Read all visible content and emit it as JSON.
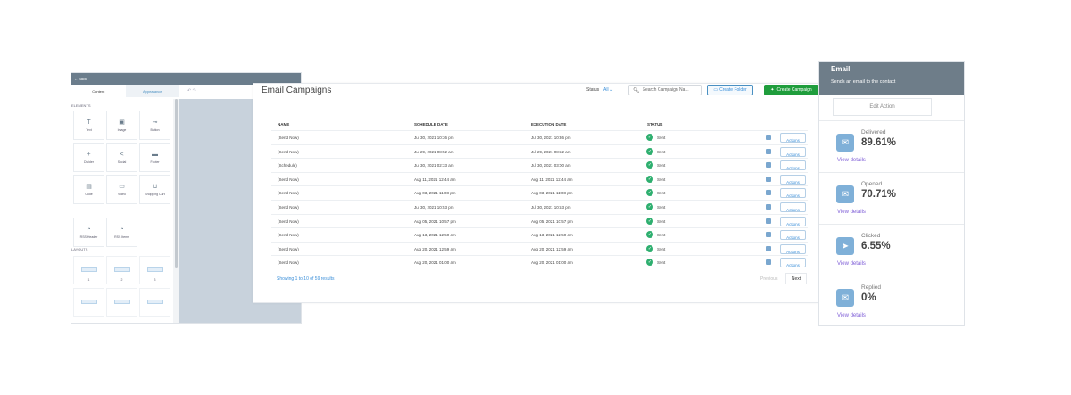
{
  "editor": {
    "back_label": "Back",
    "tabs": [
      "Content",
      "Appearance"
    ],
    "undo": "↶ ↷",
    "elements_heading": "ELEMENTS",
    "elements": [
      {
        "label": "Text",
        "icon": "text-icon",
        "glyph": "T"
      },
      {
        "label": "Image",
        "icon": "image-icon",
        "glyph": "▣"
      },
      {
        "label": "Button",
        "icon": "button-icon",
        "glyph": "⊸"
      },
      {
        "label": "Divider",
        "icon": "divider-icon",
        "glyph": "+"
      },
      {
        "label": "Social",
        "icon": "social-icon",
        "glyph": "<"
      },
      {
        "label": "Footer",
        "icon": "footer-icon",
        "glyph": "▬"
      },
      {
        "label": "Code",
        "icon": "code-icon",
        "glyph": "▤"
      },
      {
        "label": "Video",
        "icon": "video-icon",
        "glyph": "▭"
      },
      {
        "label": "Shopping Cart",
        "icon": "cart-icon",
        "glyph": "⊔"
      },
      {
        "label": "RSS Header",
        "icon": "rss-icon",
        "glyph": "◔"
      },
      {
        "label": "RSS Items",
        "icon": "rss-icon",
        "glyph": "◔"
      }
    ],
    "layouts_heading": "LAYOUTS",
    "layouts": [
      "1",
      "2",
      "3",
      "",
      "",
      ""
    ]
  },
  "campaigns": {
    "title": "Email Campaigns",
    "status_label": "Status",
    "status_value": "All",
    "search_placeholder": "Search Campaign Na...",
    "create_folder_label": "Create Folder",
    "create_campaign_label": "Create Campaign",
    "columns": [
      "NAME",
      "SCHEDULE DATE",
      "EXECUTION DATE",
      "STATUS"
    ],
    "rows": [
      {
        "name": "(Send Now)",
        "schedule": "Jul 30, 2021 10:36 pm",
        "execution": "Jul 30, 2021 10:36 pm",
        "status": "Sent",
        "action": "Actions"
      },
      {
        "name": "(Send Now)",
        "schedule": "Jul 29, 2021 08:52 am",
        "execution": "Jul 29, 2021 08:52 am",
        "status": "Sent",
        "action": "Actions"
      },
      {
        "name": "(Schedule)",
        "schedule": "Jul 30, 2021 02:33 am",
        "execution": "Jul 30, 2021 03:00 am",
        "status": "Sent",
        "action": "Actions"
      },
      {
        "name": "(Send Now)",
        "schedule": "Aug 11, 2021 12:44 am",
        "execution": "Aug 11, 2021 12:44 am",
        "status": "Sent",
        "action": "Actions"
      },
      {
        "name": "(Send Now)",
        "schedule": "Aug 03, 2021 11:08 pm",
        "execution": "Aug 03, 2021 11:08 pm",
        "status": "Sent",
        "action": "Actions"
      },
      {
        "name": "(Send Now)",
        "schedule": "Jul 30, 2021 10:53 pm",
        "execution": "Jul 30, 2021 10:53 pm",
        "status": "Sent",
        "action": "Actions"
      },
      {
        "name": "(Send Now)",
        "schedule": "Aug 05, 2021 10:57 pm",
        "execution": "Aug 05, 2021 10:57 pm",
        "status": "Sent",
        "action": "Actions"
      },
      {
        "name": "(Send Now)",
        "schedule": "Aug 13, 2021 12:50 am",
        "execution": "Aug 13, 2021 12:50 am",
        "status": "Sent",
        "action": "Actions"
      },
      {
        "name": "(Send Now)",
        "schedule": "Aug 20, 2021 12:59 am",
        "execution": "Aug 20, 2021 12:59 am",
        "status": "Sent",
        "action": "Actions"
      },
      {
        "name": "(Send Now)",
        "schedule": "Aug 20, 2021 01:00 am",
        "execution": "Aug 20, 2021 01:00 am",
        "status": "Sent",
        "action": "Actions"
      }
    ],
    "showing": "Showing 1 to 10 of 59 results",
    "previous_label": "Previous",
    "next_label": "Next"
  },
  "stats": {
    "title": "Email",
    "subtitle": "Sends an email to the contact",
    "edit_label": "Edit Action",
    "metrics": [
      {
        "label": "Delivered",
        "value": "89.61%",
        "link": "View details",
        "icon": "inbox-icon",
        "glyph": "✉"
      },
      {
        "label": "Opened",
        "value": "70.71%",
        "link": "View details",
        "icon": "open-mail-icon",
        "glyph": "✉"
      },
      {
        "label": "Clicked",
        "value": "6.55%",
        "link": "View details",
        "icon": "cursor-icon",
        "glyph": "➤"
      },
      {
        "label": "Replied",
        "value": "0%",
        "link": "View details",
        "icon": "reply-mail-icon",
        "glyph": "✉"
      }
    ]
  },
  "colors": {
    "primary_blue": "#3b8fd9",
    "create_green": "#1f9d3c",
    "sent_green": "#2eaf6f",
    "header_gray": "#6e7d89",
    "link_purple": "#7d5cd6"
  }
}
